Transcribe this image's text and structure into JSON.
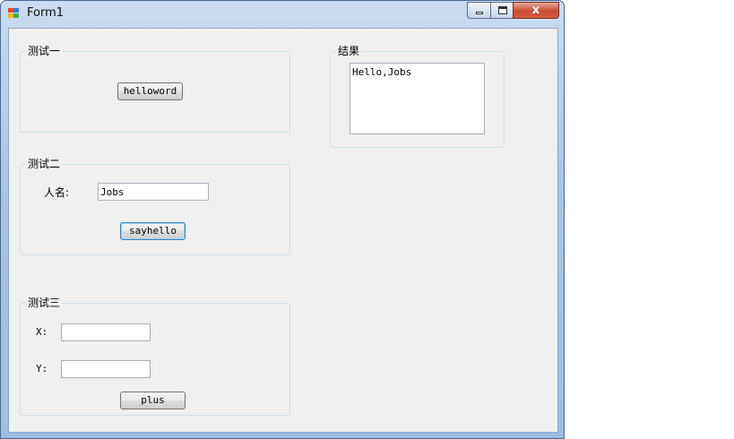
{
  "window": {
    "title": "Form1",
    "close_glyph": "x"
  },
  "groups": {
    "test1": {
      "title": "测试一",
      "button_label": "helloword"
    },
    "test2": {
      "title": "测试二",
      "name_label": "人名:",
      "name_value": "Jobs",
      "button_label": "sayhello"
    },
    "test3": {
      "title": "测试三",
      "x_label": "X:",
      "y_label": "Y:",
      "x_value": "",
      "y_value": "",
      "button_label": "plus"
    },
    "result": {
      "title": "结果",
      "text": "Hello,Jobs"
    }
  },
  "icons": {
    "app": "form-app-icon",
    "minimize": "minimize-icon",
    "maximize": "maximize-icon",
    "close": "close-icon"
  },
  "colors": {
    "client_bg": "#f0f0f0",
    "close_red": "#c94b32",
    "title_blue": "#a9c6e8"
  }
}
